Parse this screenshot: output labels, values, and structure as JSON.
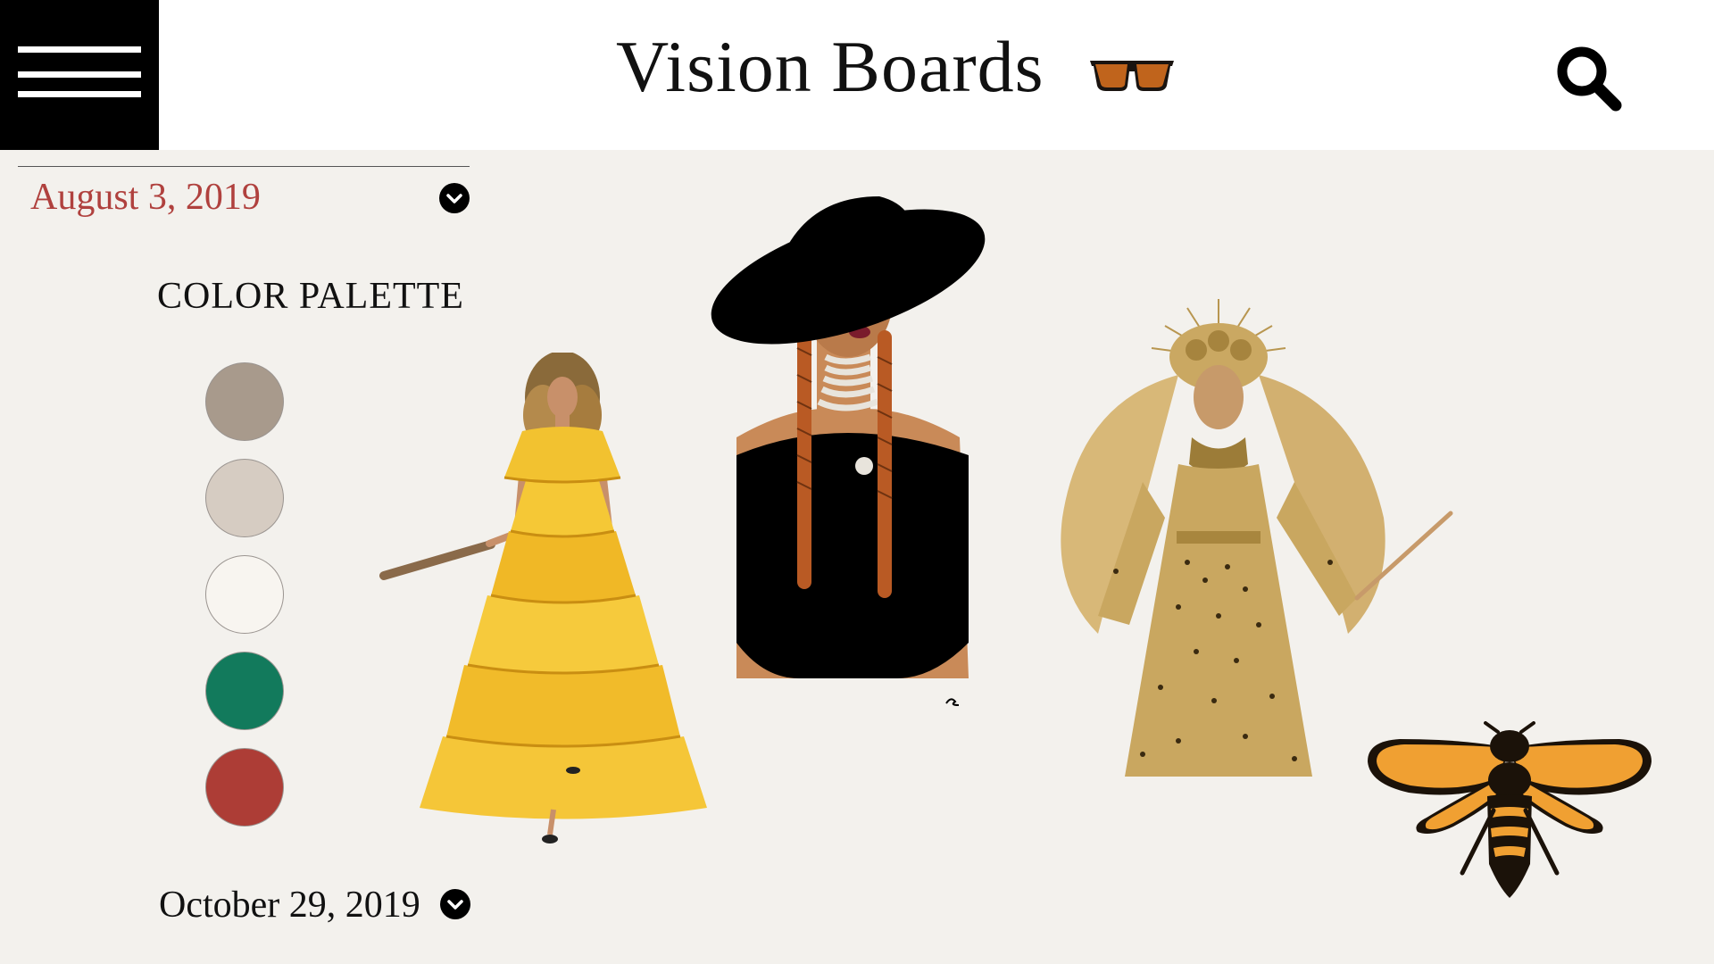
{
  "header": {
    "title": "Vision Boards",
    "menu_icon": "hamburger-menu-icon",
    "title_icon": "sunglasses-icon",
    "search_icon": "search-icon"
  },
  "sidebar": {
    "active_date": "August 3, 2019",
    "palette_title": "COLOR PALETTE",
    "swatches": [
      {
        "name": "taupe",
        "color": "#a89a8c"
      },
      {
        "name": "sand",
        "color": "#d6ccc2"
      },
      {
        "name": "ivory",
        "color": "#f8f5f0"
      },
      {
        "name": "emerald",
        "color": "#127a5c"
      },
      {
        "name": "brick",
        "color": "#ad3d36"
      }
    ],
    "next_date": "October 29, 2019"
  },
  "board": {
    "images": [
      {
        "name": "yellow-ruffle-gown-illustration"
      },
      {
        "name": "black-hat-braids-illustration"
      },
      {
        "name": "gold-crown-gown-illustration"
      },
      {
        "name": "bee-icon"
      }
    ]
  },
  "colors": {
    "accent_date": "#b0413e",
    "header_bg": "#ffffff",
    "page_bg": "#f3f1ed",
    "glasses": "#c0641c",
    "bee_orange": "#f0a032"
  }
}
